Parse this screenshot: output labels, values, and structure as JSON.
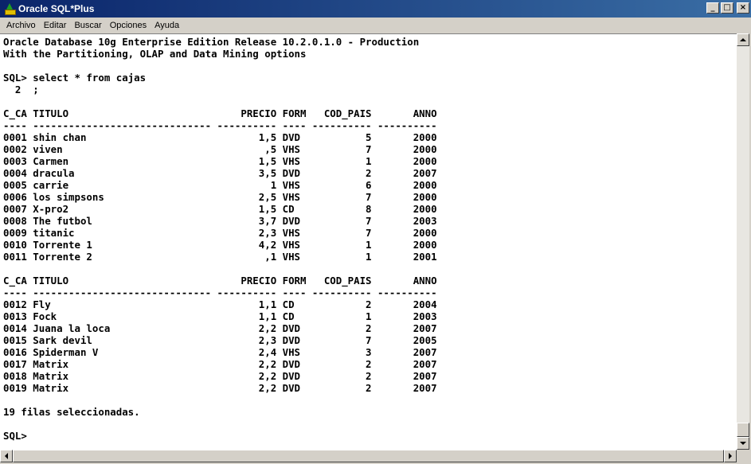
{
  "window": {
    "title": "Oracle SQL*Plus",
    "minimize_glyph": "_",
    "maximize_glyph": "□",
    "close_glyph": "×"
  },
  "menu": {
    "items": [
      "Archivo",
      "Editar",
      "Buscar",
      "Opciones",
      "Ayuda"
    ]
  },
  "console": {
    "lines": [
      "Oracle Database 10g Enterprise Edition Release 10.2.0.1.0 - Production",
      "With the Partitioning, OLAP and Data Mining options",
      "",
      "SQL> select * from cajas",
      "  2  ;",
      "",
      "C_CA TITULO                             PRECIO FORM   COD_PAIS       ANNO",
      "---- ------------------------------ ---------- ---- ---------- ----------",
      "0001 shin chan                             1,5 DVD           5       2000",
      "0002 viven                                  ,5 VHS           7       2000",
      "0003 Carmen                                1,5 VHS           1       2000",
      "0004 dracula                               3,5 DVD           2       2007",
      "0005 carrie                                  1 VHS           6       2000",
      "0006 los simpsons                          2,5 VHS           7       2000",
      "0007 X-pro2                                1,5 CD            8       2000",
      "0008 The futbol                            3,7 DVD           7       2003",
      "0009 titanic                               2,3 VHS           7       2000",
      "0010 Torrente 1                            4,2 VHS           1       2000",
      "0011 Torrente 2                             ,1 VHS           1       2001",
      "",
      "C_CA TITULO                             PRECIO FORM   COD_PAIS       ANNO",
      "---- ------------------------------ ---------- ---- ---------- ----------",
      "0012 Fly                                   1,1 CD            2       2004",
      "0013 Fock                                  1,1 CD            1       2003",
      "0014 Juana la loca                         2,2 DVD           2       2007",
      "0015 Sark devil                            2,3 DVD           7       2005",
      "0016 Spiderman V                           2,4 VHS           3       2007",
      "0017 Matrix                                2,2 DVD           2       2007",
      "0018 Matrix                                2,2 DVD           2       2007",
      "0019 Matrix                                2,2 DVD           2       2007",
      "",
      "19 filas seleccionadas.",
      "",
      "SQL>"
    ]
  }
}
